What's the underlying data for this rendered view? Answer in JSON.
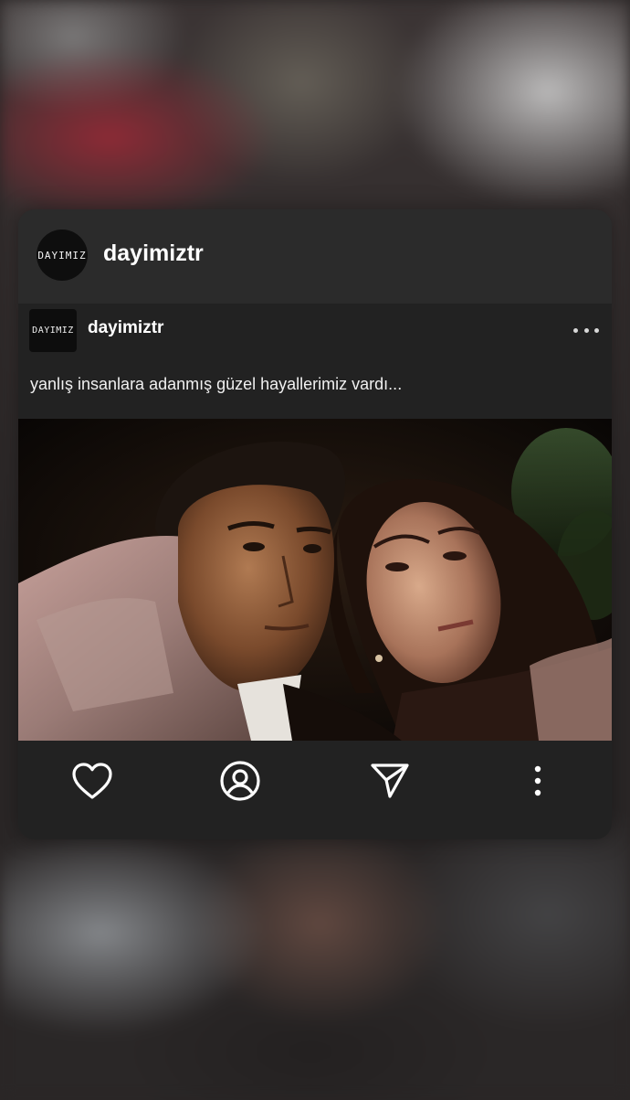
{
  "card": {
    "avatar_text": "DAYIMIZ",
    "username": "dayimiztr"
  },
  "post": {
    "avatar_text": "DAYIMIZ",
    "username": "dayimiztr",
    "caption": "yanlış insanlara adanmış güzel hayallerimiz vardı...",
    "image_description": "Movie still of a man and a woman leaning together at night"
  },
  "actions": {
    "like": "heart-icon",
    "profile": "user-circle-icon",
    "share": "paper-plane-icon",
    "more": "vertical-dots-icon"
  },
  "colors": {
    "card_bg": "#2b2b2b",
    "post_bg": "#222222",
    "text": "#ffffff"
  }
}
